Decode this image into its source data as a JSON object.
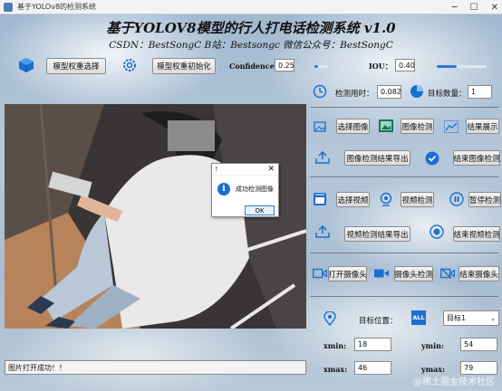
{
  "window": {
    "title": "基于YOLOv8的检测系统"
  },
  "header": {
    "title": "基于YOLOV8模型的行人打电话检测系统 v1.0",
    "subtitle": "CSDN：BestSongC   B站：Bestsongc   微信公众号：BestSongC"
  },
  "toolbar": {
    "model_select_label": "模型权重选择",
    "model_init_label": "模型权重初始化",
    "confidence_label": "Confidence：",
    "confidence_value": "0.25",
    "confidence_level": 0.25,
    "iou_label": "IOU：",
    "iou_value": "0.40",
    "iou_level": 0.4
  },
  "stats": {
    "time_label": "检测用时：",
    "time_value": "0.082",
    "count_label": "目标数量：",
    "count_value": "1"
  },
  "image_panel": {
    "select_label": "选择图像",
    "detect_label": "图像检测",
    "show_label": "结果展示",
    "export_label": "图像检测结果导出",
    "stop_label": "结束图像检测"
  },
  "video_panel": {
    "select_label": "选择视频",
    "detect_label": "视频检测",
    "pause_label": "暂停检测",
    "export_label": "视频检测结果导出",
    "stop_label": "结束视频检测"
  },
  "camera_panel": {
    "open_label": "打开摄像头",
    "detect_label": "摄像头检测",
    "close_label": "结束摄像头"
  },
  "target_panel": {
    "position_label": "目标位置：",
    "all_label": "ALL",
    "target_select": "目标1",
    "xmin_label": "xmin:",
    "xmin_value": "18",
    "ymin_label": "ymin:",
    "ymin_value": "54",
    "xmax_label": "xmax:",
    "xmax_value": "46",
    "ymax_label": "ymax:",
    "ymax_value": "79"
  },
  "dialog": {
    "title": "！",
    "message": "成功检测图像",
    "ok_label": "OK"
  },
  "status": {
    "text": "图片打开成功！！"
  },
  "watermark": "@稀土掘金技术社区",
  "colors": {
    "accent": "#2f77d0",
    "icon_blue": "#1a6fd1"
  }
}
